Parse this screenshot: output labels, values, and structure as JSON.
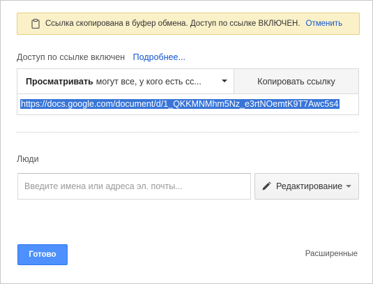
{
  "notice": {
    "message": "Ссылка скопирована в буфер обмена. Доступ по ссылке ВКЛЮЧЕН.",
    "undo_label": "Отменить",
    "icon": "clipboard-icon"
  },
  "link_sharing": {
    "status_label": "Доступ по ссылке включен",
    "more_link": "Подробнее..."
  },
  "permission": {
    "role_label": "Просматривать",
    "audience_text": "могут все, у кого есть сс...",
    "copy_button": "Копировать ссылку",
    "url": "https://docs.google.com/document/d/1_QKKMNMhm5Nz_e3rtNOemtK9T7Awc5s4"
  },
  "people": {
    "label": "Люди",
    "input_placeholder": "Введите имена или адреса эл. почты...",
    "edit_button": "Редактирование",
    "edit_icon": "pencil-icon"
  },
  "footer": {
    "done_button": "Готово",
    "advanced_link": "Расширенные"
  },
  "colors": {
    "accent": "#4d90fe",
    "link": "#1155cc",
    "notice_bg": "#fbf1c9",
    "selection": "#3875d7"
  }
}
